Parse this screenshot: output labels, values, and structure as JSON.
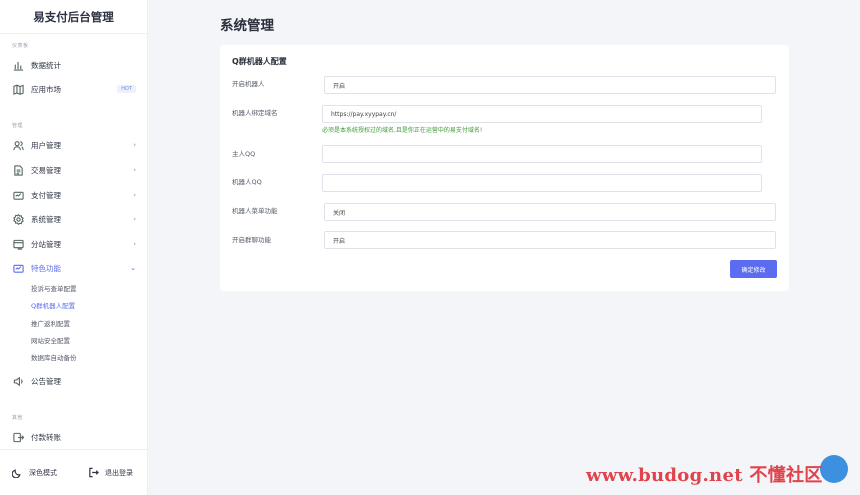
{
  "sidebar": {
    "brand": "易支付后台管理",
    "sections": {
      "dashboard": "仪表板",
      "manage": "管理",
      "other": "其他"
    },
    "items": [
      {
        "label": "数据统计",
        "icon": "bar-chart-icon"
      },
      {
        "label": "应用市场",
        "icon": "map-icon",
        "badge": "HOT"
      },
      {
        "label": "用户管理",
        "icon": "users-icon",
        "chevron": "›"
      },
      {
        "label": "交易管理",
        "icon": "document-icon",
        "chevron": "›"
      },
      {
        "label": "支付管理",
        "icon": "payment-icon",
        "chevron": "›"
      },
      {
        "label": "系统管理",
        "icon": "gear-icon",
        "chevron": "›"
      },
      {
        "label": "分站管理",
        "icon": "site-icon",
        "chevron": "›"
      },
      {
        "label": "特色功能",
        "icon": "feature-icon",
        "chevron": "⌄"
      },
      {
        "label": "公告管理",
        "icon": "speaker-icon"
      },
      {
        "label": "付款转账",
        "icon": "transfer-icon"
      }
    ],
    "submenu": [
      "投诉与查单配置",
      "Q群机器人配置",
      "推广返利配置",
      "网站安全配置",
      "数据库自动备份"
    ],
    "footer": {
      "dark_mode": "深色模式",
      "logout": "退出登录"
    }
  },
  "main": {
    "page_title": "系统管理",
    "card_title": "Q群机器人配置",
    "fields": [
      {
        "label": "开启机器人",
        "value": "开启"
      },
      {
        "label": "机器人绑定域名",
        "value": "https://pay.xyypay.cn/"
      },
      {
        "label": "主人QQ",
        "value": ""
      },
      {
        "label": "机器人QQ",
        "value": ""
      },
      {
        "label": "机器人菜单功能",
        "value": "关闭"
      },
      {
        "label": "开启群聊功能",
        "value": "开启"
      }
    ],
    "domain_help": "必须是本系统授权过的域名,且是你正在运营中的易支付域名!",
    "submit_label": "确定修改"
  },
  "watermark": "www.budog.net 不懂社区",
  "colors": {
    "accent": "#5b6cf0",
    "help_text": "#3f9a37",
    "watermark": "#e0434b"
  }
}
